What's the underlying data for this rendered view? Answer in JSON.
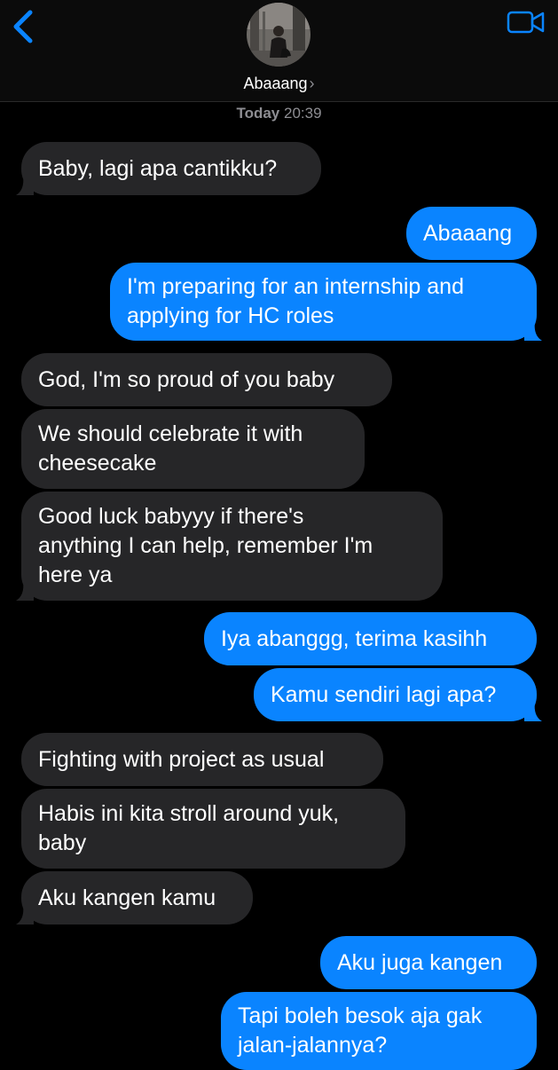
{
  "header": {
    "contact_name": "Abaaang",
    "chevron": "›",
    "back_icon": "chevron-left-icon",
    "video_icon": "facetime-video-icon",
    "accent_color": "#0a84ff"
  },
  "timestamp": {
    "day": "Today",
    "time": "20:39"
  },
  "messages": [
    {
      "from": "contact",
      "text": "Baby, lagi apa cantikku?"
    },
    {
      "from": "me",
      "text": "Abaaang"
    },
    {
      "from": "me",
      "text": "I'm preparing for an internship and\napplying for HC roles"
    },
    {
      "from": "contact",
      "text": "God, I'm so proud of you baby"
    },
    {
      "from": "contact",
      "text": "We should celebrate it with\ncheesecake"
    },
    {
      "from": "contact",
      "text": "Good luck babyyy if there's\nanything I can help, remember I'm\nhere ya"
    },
    {
      "from": "me",
      "text": "Iya abanggg, terima kasihh"
    },
    {
      "from": "me",
      "text": "Kamu sendiri lagi apa?"
    },
    {
      "from": "contact",
      "text": "Fighting with project as usual"
    },
    {
      "from": "contact",
      "text": "Habis ini kita stroll around yuk,\nbaby"
    },
    {
      "from": "contact",
      "text": "Aku kangen kamu"
    },
    {
      "from": "me",
      "text": "Aku juga kangen"
    },
    {
      "from": "me",
      "text": "Tapi boleh besok aja gak\njalan-jalannya?"
    }
  ]
}
